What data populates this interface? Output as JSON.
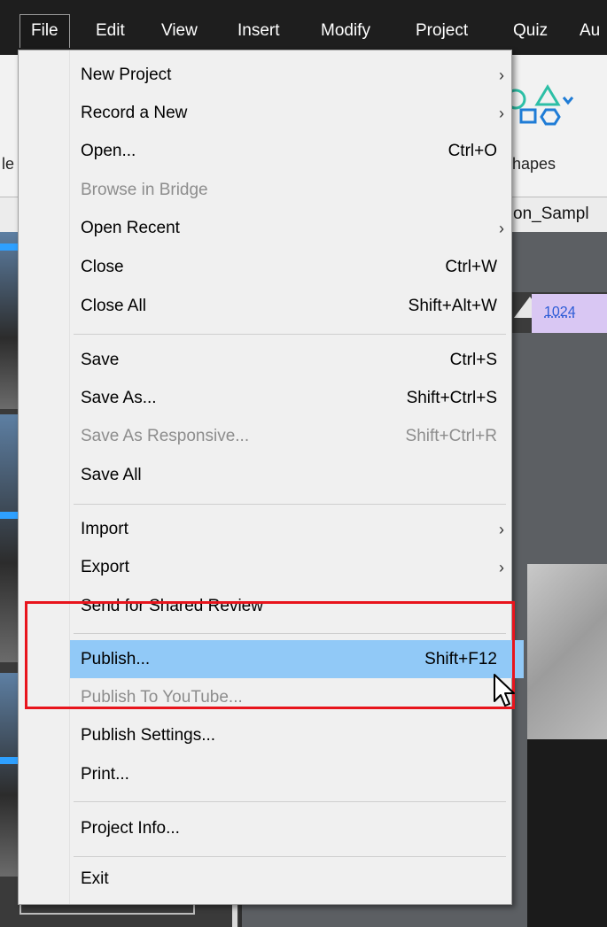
{
  "menubar": {
    "items": [
      {
        "label": "File"
      },
      {
        "label": "Edit"
      },
      {
        "label": "View"
      },
      {
        "label": "Insert"
      },
      {
        "label": "Modify"
      },
      {
        "label": "Project"
      },
      {
        "label": "Quiz"
      },
      {
        "label": "Au"
      }
    ]
  },
  "ribbon": {
    "shapes_label": "hapes",
    "left_fragment": "le"
  },
  "document": {
    "tab_label": "on_Sampl"
  },
  "timeline": {
    "marker_value": "1024"
  },
  "file_menu": {
    "items": [
      {
        "label": "New Project",
        "shortcut": "",
        "submenu": true,
        "disabled": false
      },
      {
        "label": "Record a New",
        "shortcut": "",
        "submenu": true,
        "disabled": false
      },
      {
        "label": "Open...",
        "shortcut": "Ctrl+O",
        "submenu": false,
        "disabled": false
      },
      {
        "label": "Browse in Bridge",
        "shortcut": "",
        "submenu": false,
        "disabled": true
      },
      {
        "label": "Open Recent",
        "shortcut": "",
        "submenu": true,
        "disabled": false
      },
      {
        "label": "Close",
        "shortcut": "Ctrl+W",
        "submenu": false,
        "disabled": false
      },
      {
        "label": "Close All",
        "shortcut": "Shift+Alt+W",
        "submenu": false,
        "disabled": false
      },
      {
        "label": "Save",
        "shortcut": "Ctrl+S",
        "submenu": false,
        "disabled": false
      },
      {
        "label": "Save As...",
        "shortcut": "Shift+Ctrl+S",
        "submenu": false,
        "disabled": false
      },
      {
        "label": "Save As Responsive...",
        "shortcut": "Shift+Ctrl+R",
        "submenu": false,
        "disabled": true
      },
      {
        "label": "Save All",
        "shortcut": "",
        "submenu": false,
        "disabled": false
      },
      {
        "label": "Import",
        "shortcut": "",
        "submenu": true,
        "disabled": false
      },
      {
        "label": "Export",
        "shortcut": "",
        "submenu": true,
        "disabled": false
      },
      {
        "label": "Send for Shared Review",
        "shortcut": "",
        "submenu": false,
        "disabled": false
      },
      {
        "label": "Publish...",
        "shortcut": "Shift+F12",
        "submenu": false,
        "disabled": false,
        "highlighted": true
      },
      {
        "label": "Publish To YouTube...",
        "shortcut": "",
        "submenu": false,
        "disabled": true
      },
      {
        "label": "Publish Settings...",
        "shortcut": "",
        "submenu": false,
        "disabled": false
      },
      {
        "label": "Print...",
        "shortcut": "",
        "submenu": false,
        "disabled": false
      },
      {
        "label": "Project Info...",
        "shortcut": "",
        "submenu": false,
        "disabled": false
      },
      {
        "label": "Exit",
        "shortcut": "",
        "submenu": false,
        "disabled": false
      }
    ],
    "submenu_glyph": "›"
  },
  "colors": {
    "highlight": "#91c9f7",
    "annotation": "#e8141c",
    "menu_bg": "#f0f0f0",
    "disabled_text": "#8d8d8d"
  },
  "icons": [
    "chevron-right-icon",
    "shapes-icon",
    "mouse-pointer-icon"
  ]
}
